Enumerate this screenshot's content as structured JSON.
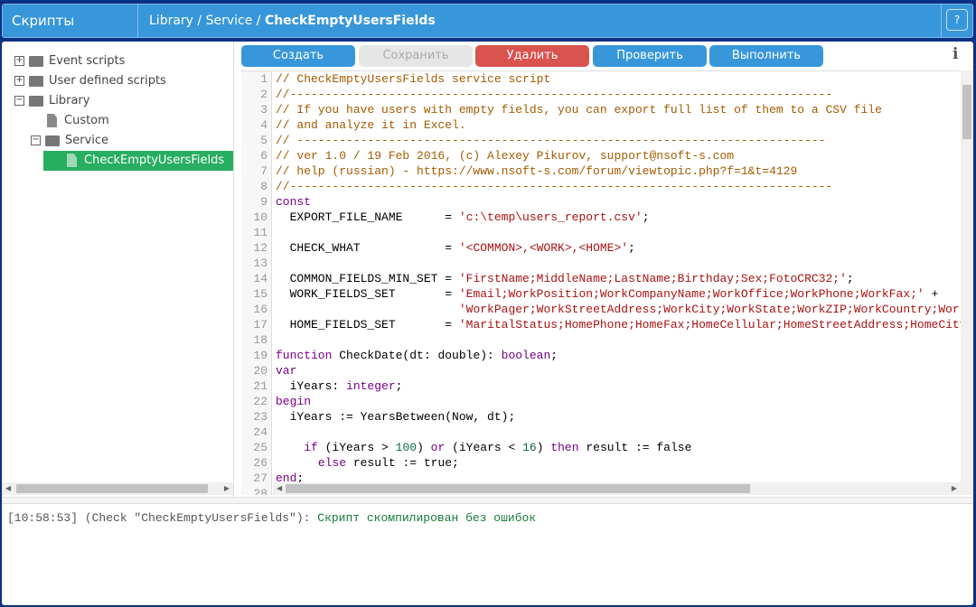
{
  "header": {
    "app_title": "Скрипты",
    "breadcrumb_path": "Library / Service / ",
    "breadcrumb_current": "CheckEmptyUsersFields",
    "help_label": "?"
  },
  "tree": [
    {
      "label": "Event scripts",
      "type": "folder",
      "expander": "+",
      "level": 0
    },
    {
      "label": "User defined scripts",
      "type": "folder",
      "expander": "+",
      "level": 0
    },
    {
      "label": "Library",
      "type": "folder-open",
      "expander": "−",
      "level": 0
    },
    {
      "label": "Custom",
      "type": "file",
      "level": 1
    },
    {
      "label": "Service",
      "type": "folder-open",
      "expander": "−",
      "level": 1
    },
    {
      "label": "CheckEmptyUsersFields",
      "type": "file",
      "level": 2,
      "selected": true
    }
  ],
  "toolbar": {
    "create": "Создать",
    "save": "Сохранить",
    "delete": "Удалить",
    "check": "Проверить",
    "run": "Выполнить",
    "info_icon": "i"
  },
  "colors": {
    "primary": "#3797da",
    "danger": "#d9534f",
    "selected": "#27ae60"
  },
  "code": [
    [
      [
        "c",
        "// CheckEmptyUsersFields service script"
      ]
    ],
    [
      [
        "c",
        "//-----------------------------------------------------------------------------"
      ]
    ],
    [
      [
        "c",
        "// If you have users with empty fields, you can export full list of them to a CSV file"
      ]
    ],
    [
      [
        "c",
        "// and analyze it in Excel."
      ]
    ],
    [
      [
        "c",
        "// ---------------------------------------------------------------------------"
      ]
    ],
    [
      [
        "c",
        "// ver 1.0 / 19 Feb 2016, (c) Alexey Pikurov, support@nsoft-s.com"
      ]
    ],
    [
      [
        "c",
        "// help (russian) - https://www.nsoft-s.com/forum/viewtopic.php?f=1&t=4129"
      ]
    ],
    [
      [
        "c",
        "//-----------------------------------------------------------------------------"
      ]
    ],
    [
      [
        "k",
        "const"
      ]
    ],
    [
      [
        "p",
        "  EXPORT_FILE_NAME      = "
      ],
      [
        "s",
        "'c:\\temp\\users_report.csv'"
      ],
      [
        "p",
        ";"
      ]
    ],
    [],
    [
      [
        "p",
        "  CHECK_WHAT            = "
      ],
      [
        "s",
        "'<COMMON>,<WORK>,<HOME>'"
      ],
      [
        "p",
        ";"
      ]
    ],
    [],
    [
      [
        "p",
        "  COMMON_FIELDS_MIN_SET = "
      ],
      [
        "s",
        "'FirstName;MiddleName;LastName;Birthday;Sex;FotoCRC32;'"
      ],
      [
        "p",
        ";"
      ]
    ],
    [
      [
        "p",
        "  WORK_FIELDS_SET       = "
      ],
      [
        "s",
        "'Email;WorkPosition;WorkCompanyName;WorkOffice;WorkPhone;WorkFax;'"
      ],
      [
        "p",
        " +"
      ]
    ],
    [
      [
        "p",
        "                          "
      ],
      [
        "s",
        "'WorkPager;WorkStreetAddress;WorkCity;WorkState;WorkZIP;WorkCountry;WorkWebPage;'"
      ]
    ],
    [
      [
        "p",
        "  HOME_FIELDS_SET       = "
      ],
      [
        "s",
        "'MaritalStatus;HomePhone;HomeFax;HomeCellular;HomeStreetAddress;HomeCity;HomeState;'"
      ]
    ],
    [],
    [
      [
        "k",
        "function"
      ],
      [
        "p",
        " CheckDate(dt: double): "
      ],
      [
        "k",
        "boolean"
      ],
      [
        "p",
        ";"
      ]
    ],
    [
      [
        "k",
        "var"
      ]
    ],
    [
      [
        "p",
        "  iYears: "
      ],
      [
        "k",
        "integer"
      ],
      [
        "p",
        ";"
      ]
    ],
    [
      [
        "k",
        "begin"
      ]
    ],
    [
      [
        "p",
        "  iYears := YearsBetween(Now, dt);"
      ]
    ],
    [],
    [
      [
        "p",
        "    "
      ],
      [
        "k",
        "if"
      ],
      [
        "p",
        " (iYears > "
      ],
      [
        "n",
        "100"
      ],
      [
        "p",
        ") "
      ],
      [
        "k",
        "or"
      ],
      [
        "p",
        " (iYears < "
      ],
      [
        "n",
        "16"
      ],
      [
        "p",
        ") "
      ],
      [
        "k",
        "then"
      ],
      [
        "p",
        " result := false"
      ]
    ],
    [
      [
        "p",
        "      "
      ],
      [
        "k",
        "else"
      ],
      [
        "p",
        " result := true;"
      ]
    ],
    [
      [
        "k",
        "end"
      ],
      [
        "p",
        ";"
      ]
    ],
    []
  ],
  "log": {
    "prefix": "[10:58:53] (Check \"CheckEmptyUsersFields\"): ",
    "message": "Скрипт скомпилирован без ошибок"
  }
}
